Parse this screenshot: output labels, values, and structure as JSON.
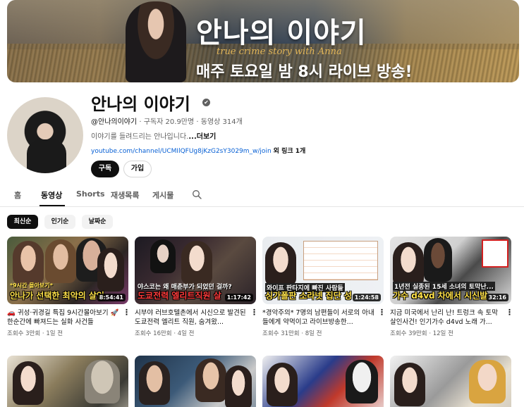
{
  "banner": {
    "title": "안나의 이야기",
    "subtitle": "true crime story with Anna",
    "live_notice": "매주 토요일 밤 8시 라이브 방송!"
  },
  "channel": {
    "name": "안나의 이야기",
    "verified_glyph": "✔",
    "handle": "@안나의이야기",
    "subscribers": "구독자 20.9만명",
    "video_count": "동영상 314개",
    "separator": "·",
    "description": "이야기를 들려드리는 안나입니다.",
    "more_label": "...더보기",
    "link_url": "youtube.com/channel/UCMIlQFUg8jKzG2sY3029m_w/join",
    "link_extra": "외 링크 1개",
    "subscribe_label": "구독",
    "join_label": "가입"
  },
  "tabs": [
    "홈",
    "동영상",
    "Shorts",
    "재생목록",
    "게시물"
  ],
  "active_tab": "동영상",
  "chips": [
    "최신순",
    "인기순",
    "날짜순"
  ],
  "active_chip": "최신순",
  "videos": [
    {
      "thumb_caption": "안나가 선택한 최악의 살인",
      "thumb_tag": "*9시간 몰아보기*",
      "duration": "8:54:41",
      "title": "🚗 귀성·귀경길 특집 9시간몰아보기 🚀 한순간에 빠져드는 실화 사건들",
      "views": "조회수 3만회",
      "age": "1일 전"
    },
    {
      "thumb_caption": "도쿄전력 엘리트직원 살",
      "thumb_tag": "야스코는 왜 매춘부가 되었던 걸까?",
      "duration": "1:17:42",
      "title": "시부야 러브호텔촌에서 시신으로 발견된 도쿄전력 엘리트 직원, 숨겨왔...",
      "views": "조회수 16만회",
      "age": "4일 전"
    },
    {
      "thumb_caption": "싱가폴판 소라넷 집단 성",
      "thumb_tag": "와이프 판타지에 빠진 사람들",
      "duration": "1:24:58",
      "title": "*경악주의* 7명의 남편들이 서로의 아내들에게 약먹이고 라이브방송한...",
      "views": "조회수 31만회",
      "age": "8일 전"
    },
    {
      "thumb_caption": "가수 d4vd 차에서 시신발",
      "thumb_tag": "1년전 실종된 15세 소녀의 토막난...",
      "duration": "32:16",
      "title": "지금 미국에서 난리 난! 트렁크 속 토막살인사건! 인기가수 d4vd 노래 가...",
      "views": "조회수 39만회",
      "age": "12일 전"
    }
  ],
  "colors": {
    "accent_link": "#065fd4",
    "text_primary": "#0f0f0f",
    "text_secondary": "#606060",
    "thumb_caption": "#ffe14a"
  }
}
